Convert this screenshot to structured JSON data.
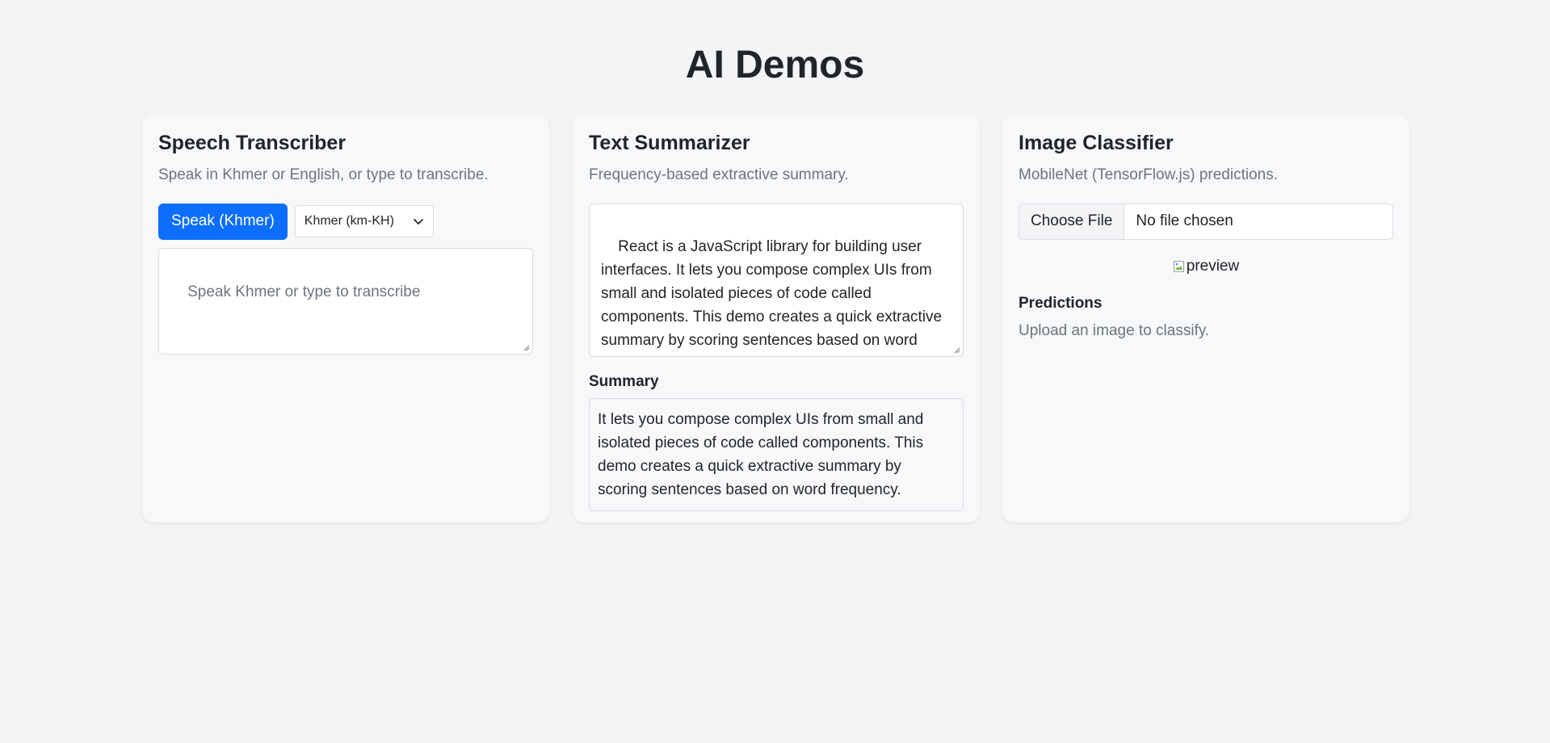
{
  "page": {
    "title": "AI Demos"
  },
  "speech": {
    "title": "Speech Transcriber",
    "subtitle": "Speak in Khmer or English, or type to transcribe.",
    "speak_button": "Speak (Khmer)",
    "language_select": {
      "selected": "Khmer (km-KH)",
      "icon": "chevron-down-icon"
    },
    "textarea": {
      "value": "",
      "placeholder": "Speak Khmer or type to transcribe"
    }
  },
  "summarizer": {
    "title": "Text Summarizer",
    "subtitle": "Frequency-based extractive summary.",
    "input_text": "React is a JavaScript library for building user interfaces. It lets you compose complex UIs from small and isolated pieces of code called components. This demo creates a quick extractive summary by scoring sentences based on word frequency.",
    "summary_label": "Summary",
    "summary_text": "It lets you compose complex UIs from small and isolated pieces of code called components. This demo creates a quick extractive summary by scoring sentences based on word frequency."
  },
  "classifier": {
    "title": "Image Classifier",
    "subtitle": "MobileNet (TensorFlow.js) predictions.",
    "file_button": "Choose File",
    "file_status": "No file chosen",
    "preview_alt": "preview",
    "predictions_label": "Predictions",
    "predictions_empty": "Upload an image to classify."
  },
  "colors": {
    "background": "#f3f4f6",
    "card": "#f7f8fa",
    "primary": "#0d6efd",
    "muted_text": "#6c757d",
    "border": "#d9dde2"
  }
}
